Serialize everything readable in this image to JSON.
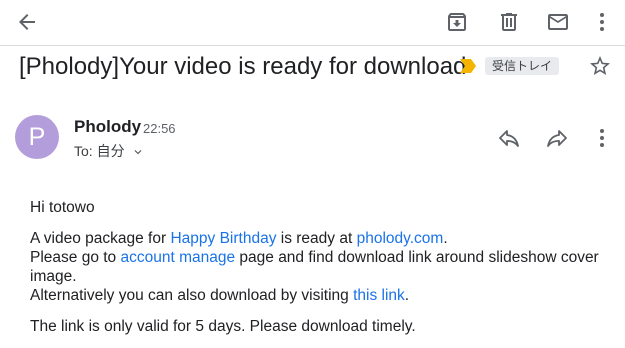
{
  "toolbar": {
    "back_icon": "arrow-back-icon",
    "archive_icon": "archive-icon",
    "delete_icon": "trash-icon",
    "mark_unread_icon": "mail-icon",
    "more_icon": "more-vert-icon"
  },
  "subject": {
    "text": "[Pholody]Your video is ready for download",
    "importance_color": "#f4b400",
    "label": "受信トレイ"
  },
  "message": {
    "avatar_letter": "P",
    "avatar_color": "#b39ddb",
    "sender": "Pholody",
    "time": "22:56",
    "to": "To: 自分"
  },
  "body": {
    "greeting": "Hi totowo",
    "p1_a": "A video package for ",
    "p1_link1": "Happy Birthday",
    "p1_b": " is ready at ",
    "p1_link2": "pholody.com",
    "p1_c": ".",
    "p2_a": "Please go to ",
    "p2_link": "account manage",
    "p2_b": " page and find download link around slideshow cover image.",
    "p3_a": "Alternatively you can also download by visiting ",
    "p3_link": "this link",
    "p3_b": ".",
    "p4": "The link is only valid for 5 days. Please download timely."
  },
  "colors": {
    "link": "#1a73e8",
    "icon": "#5f6368"
  }
}
